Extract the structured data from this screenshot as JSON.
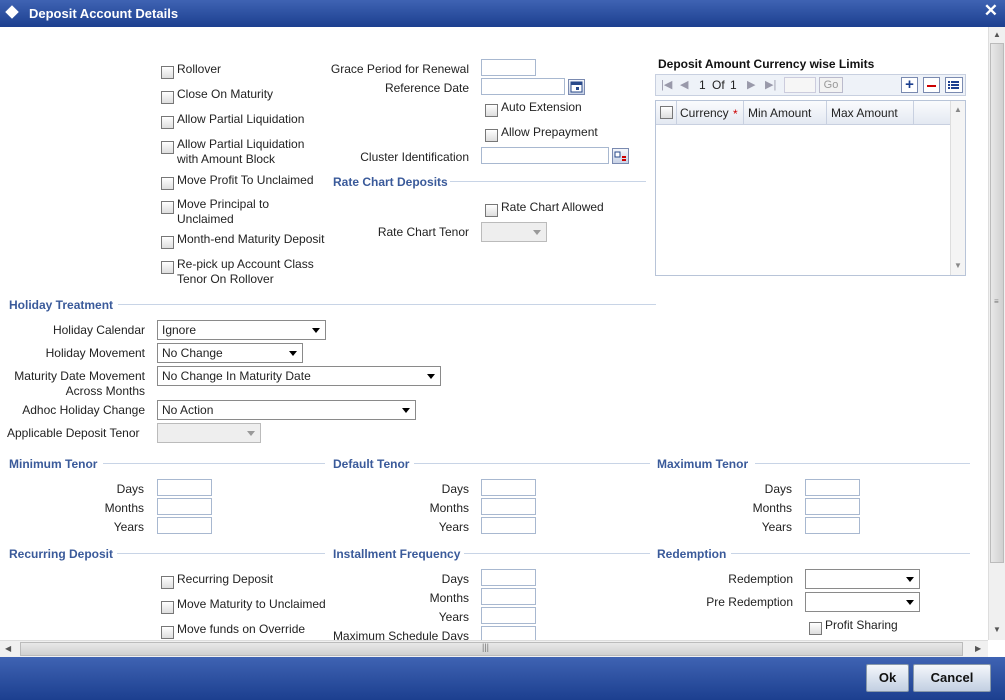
{
  "window": {
    "title": "Deposit Account Details",
    "close_label": "✕"
  },
  "options": {
    "rollover": "Rollover",
    "close_on_maturity": "Close On Maturity",
    "allow_partial_liquidation": "Allow Partial Liquidation",
    "allow_partial_liq_amount_block_1": "Allow Partial Liquidation",
    "allow_partial_liq_amount_block_2": "with Amount Block",
    "move_profit_unclaimed": "Move Profit To Unclaimed",
    "move_principal_unclaimed_1": "Move Principal to",
    "move_principal_unclaimed_2": "Unclaimed",
    "month_end_maturity": "Month-end Maturity Deposit",
    "repick_1": "Re-pick up Account Class",
    "repick_2": "Tenor On Rollover"
  },
  "renewal": {
    "grace_period_label": "Grace Period for Renewal",
    "reference_date_label": "Reference Date",
    "auto_extension": "Auto Extension",
    "allow_prepayment": "Allow Prepayment",
    "cluster_identification_label": "Cluster Identification"
  },
  "rate_chart": {
    "section": "Rate Chart Deposits",
    "allowed": "Rate Chart Allowed",
    "tenor_label": "Rate Chart Tenor"
  },
  "limits": {
    "title": "Deposit Amount Currency wise Limits",
    "page_current": "1",
    "page_of": "Of",
    "page_total": "1",
    "go": "Go",
    "add_icon": "plus-icon",
    "remove_icon": "minus-icon",
    "details_icon": "list-icon",
    "columns": [
      "Currency",
      "Min Amount",
      "Max Amount"
    ],
    "required_mark": "*"
  },
  "holiday": {
    "section": "Holiday Treatment",
    "calendar_label": "Holiday Calendar",
    "calendar_value": "Ignore",
    "movement_label": "Holiday Movement",
    "movement_value": "No Change",
    "maturity_move_label_1": "Maturity Date Movement",
    "maturity_move_label_2": "Across Months",
    "maturity_move_value": "No Change In Maturity Date",
    "adhoc_label": "Adhoc Holiday Change",
    "adhoc_value": "No Action",
    "applicable_tenor_label": "Applicable Deposit Tenor"
  },
  "tenor": {
    "minimum": "Minimum Tenor",
    "default": "Default Tenor",
    "maximum": "Maximum Tenor",
    "days": "Days",
    "months": "Months",
    "years": "Years"
  },
  "recurring": {
    "section": "Recurring Deposit",
    "recurring_deposit": "Recurring Deposit",
    "move_maturity_unclaimed": "Move Maturity to Unclaimed",
    "move_funds_override": "Move funds on Override"
  },
  "installment": {
    "section": "Installment Frequency",
    "days": "Days",
    "months": "Months",
    "years": "Years",
    "max_schedule_days": "Maximum Schedule Days"
  },
  "redemption": {
    "section": "Redemption",
    "redemption_label": "Redemption",
    "pre_redemption_label": "Pre Redemption",
    "profit_sharing": "Profit Sharing"
  },
  "scrollbar": {
    "grip": "|||"
  },
  "footer": {
    "ok": "Ok",
    "cancel": "Cancel"
  },
  "colors": {
    "title_bar": "#1c3f8f",
    "section_text": "#3a5a9a",
    "footer_bar": "#1c3f8f"
  }
}
